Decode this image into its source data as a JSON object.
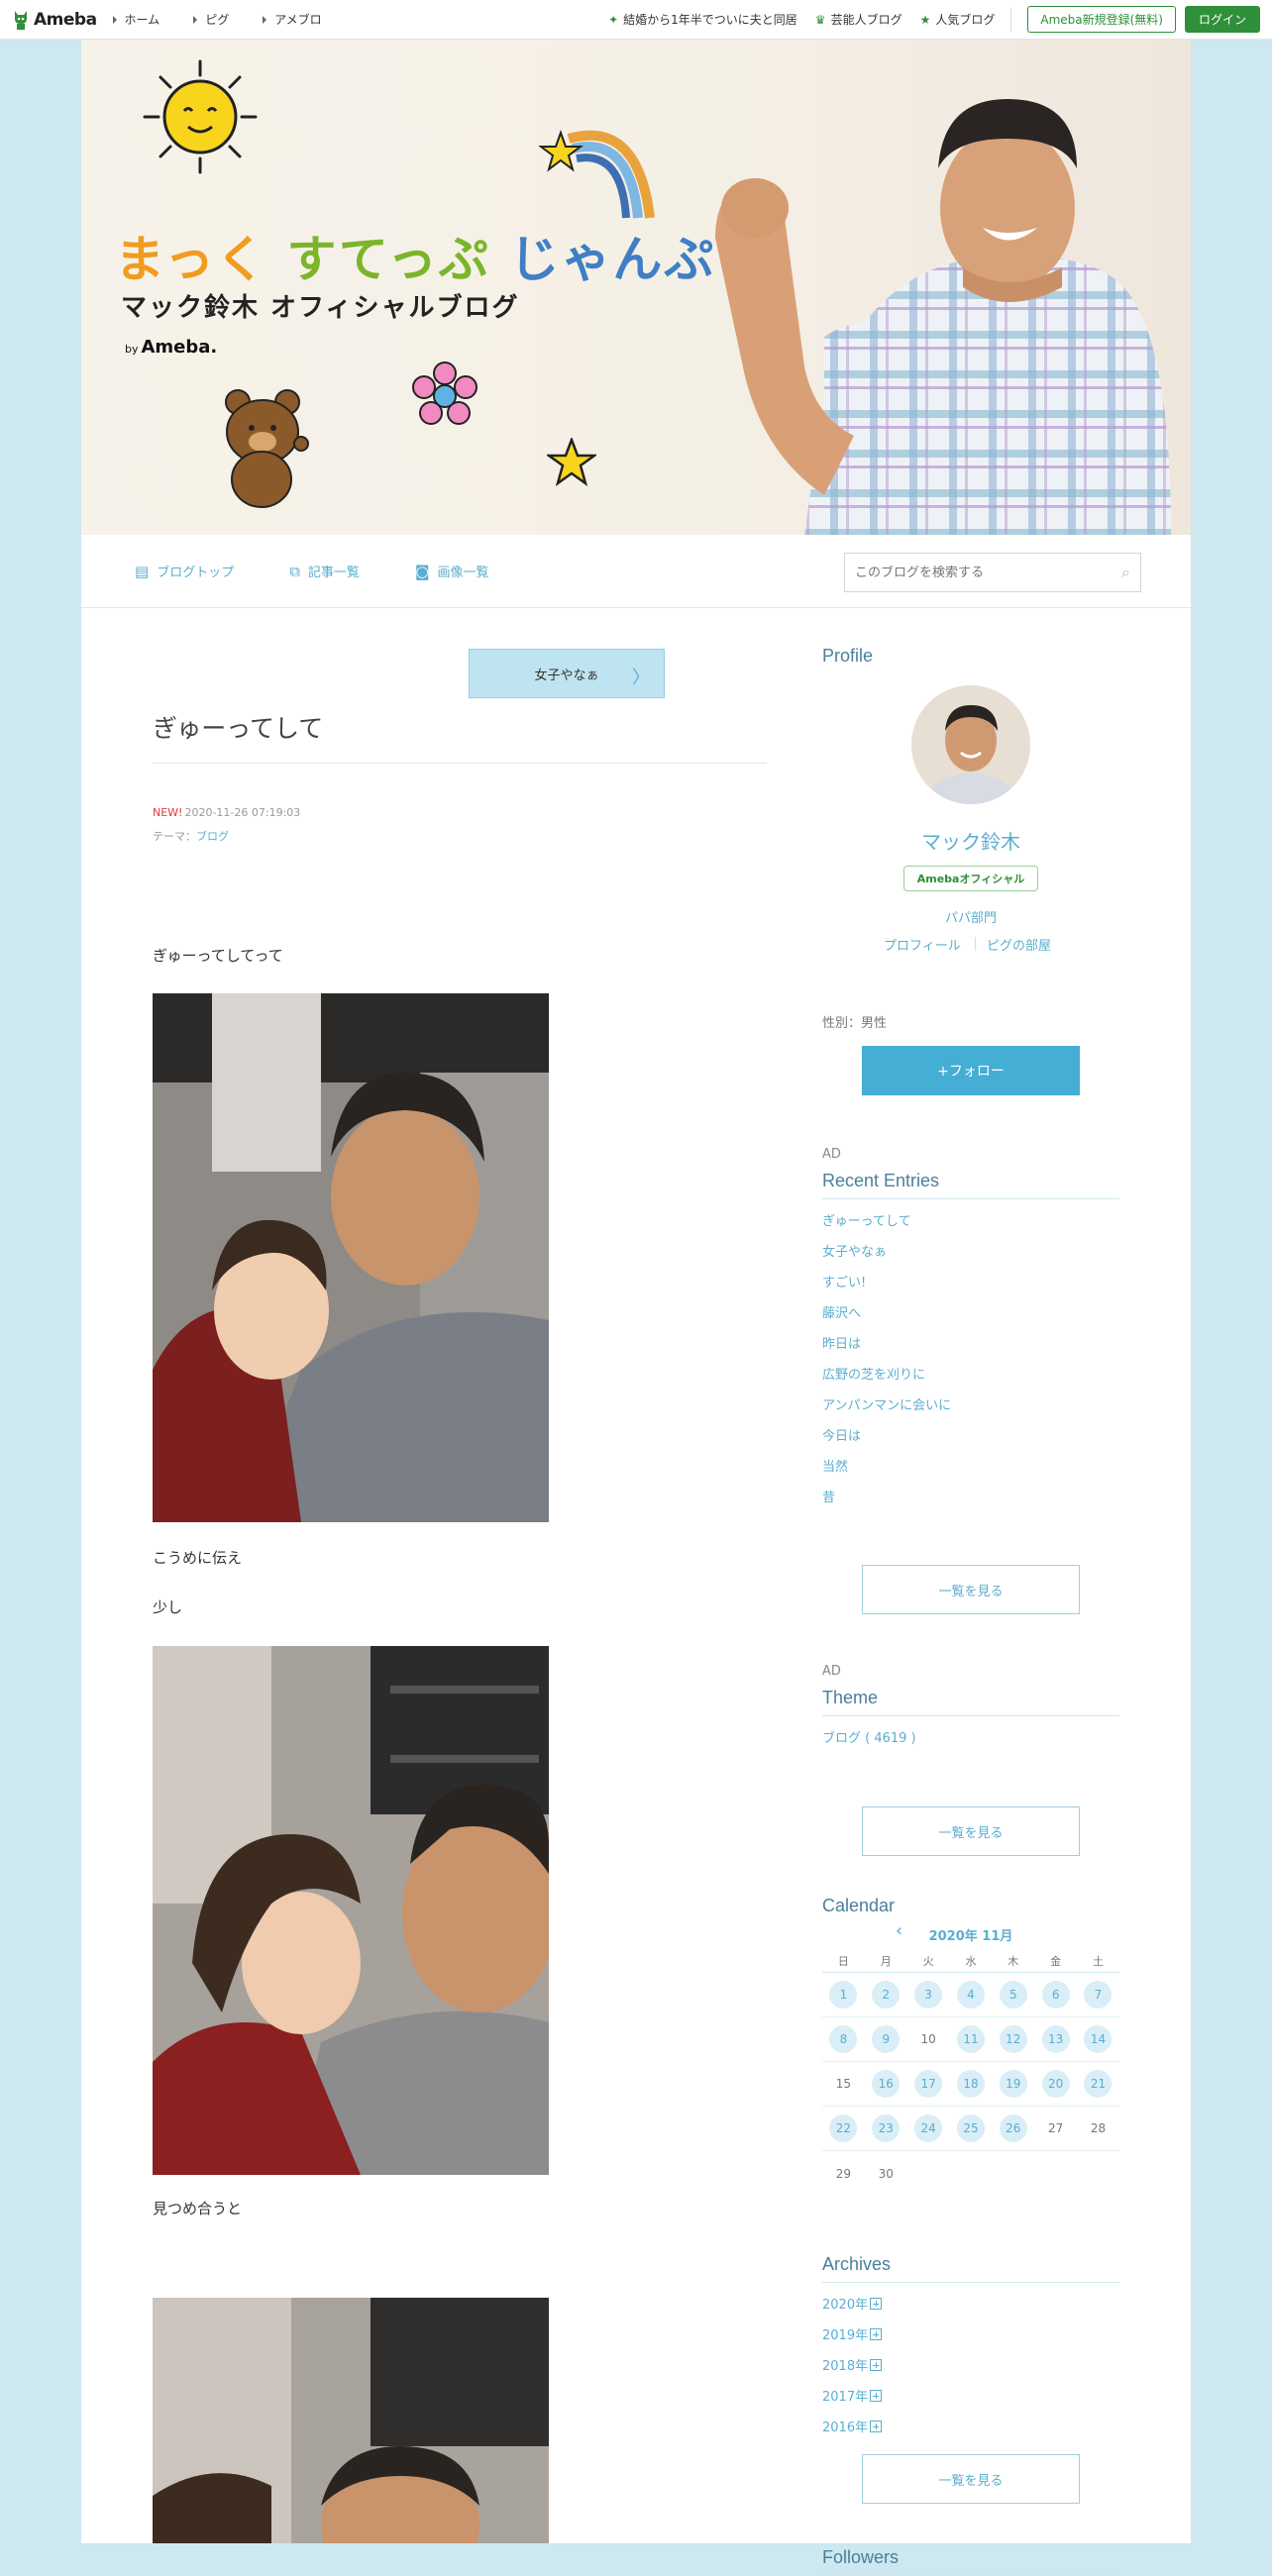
{
  "topbar": {
    "brand": "Ameba",
    "nav": [
      "ホーム",
      "ピグ",
      "アメブロ"
    ],
    "links": [
      {
        "label": "結婚から1年半でついに夫と同居",
        "icon": "sparkle-icon"
      },
      {
        "label": "芸能人ブログ",
        "icon": "crown-icon"
      },
      {
        "label": "人気ブログ",
        "icon": "star-icon"
      }
    ],
    "register_label": "Ameba新規登録(無料)",
    "login_label": "ログイン"
  },
  "banner": {
    "title_part1": "まっく",
    "title_part2": "すてっぷ",
    "title_part3": "じゃんぷ",
    "subtitle": "マック鈴木 オフィシャルブログ",
    "by_prefix": "by",
    "by_brand": "Ameba."
  },
  "blognav": {
    "items": [
      "ブログトップ",
      "記事一覧",
      "画像一覧"
    ],
    "search_placeholder": "このブログを検索する"
  },
  "article": {
    "next_label": "女子やなぁ",
    "title": "ぎゅーってして",
    "new_badge": "NEW!",
    "datetime": "2020-11-26 07:19:03",
    "theme_prefix": "テーマ：",
    "theme": "ブログ",
    "text1": "ぎゅーってしてって",
    "text2": "こうめに伝え",
    "text3": "少し",
    "text4": "見つめ合うと"
  },
  "sidebar": {
    "profile_heading": "Profile",
    "name": "マック鈴木",
    "badge": "Amebaオフィシャル",
    "category": "パパ部門",
    "profile_link": "プロフィール",
    "pigg_link": "ピグの部屋",
    "gender": "性別：男性",
    "follow_label": "+フォロー",
    "ad_label": "AD",
    "recent_heading": "Recent Entries",
    "recent": [
      "ぎゅーってして",
      "女子やなぁ",
      "すごい!",
      "藤沢へ",
      "昨日は",
      "広野の芝を刈りに",
      "アンパンマンに会いに",
      "今日は",
      "当然",
      "昔"
    ],
    "more_label": "一覧を見る",
    "theme_heading": "Theme",
    "theme_item": "ブログ ( 4619 )",
    "calendar_heading": "Calendar",
    "calendar_month": "2020年 11月",
    "weekdays": [
      "日",
      "月",
      "火",
      "水",
      "木",
      "金",
      "土"
    ],
    "archives_heading": "Archives",
    "archives": [
      "2020年",
      "2019年",
      "2018年",
      "2017年",
      "2016年"
    ],
    "followers_heading": "Followers"
  },
  "colors": {
    "accent": "#5aaed0",
    "ameba_green": "#2f8f3a",
    "page_bg": "#cde8f1",
    "follow_bg": "#44aed4"
  }
}
